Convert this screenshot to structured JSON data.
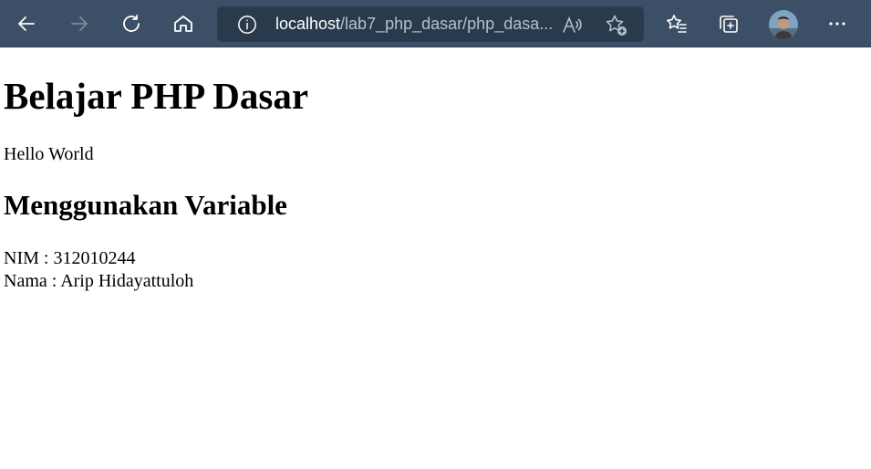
{
  "browser": {
    "url_host": "localhost",
    "url_path": "/lab7_php_dasar/php_dasa...",
    "colors": {
      "toolbar": "#3b4f66",
      "address_bar": "#2a3a4d"
    },
    "icons": [
      "back-arrow-icon",
      "forward-arrow-icon",
      "refresh-icon",
      "home-icon",
      "site-info-icon",
      "read-aloud-icon",
      "add-favorite-icon",
      "favorites-icon",
      "collections-icon",
      "avatar",
      "more-icon"
    ]
  },
  "page": {
    "heading": "Belajar PHP Dasar",
    "hello": "Hello World",
    "subheading": "Menggunakan Variable",
    "nim": "NIM : 312010244",
    "nama": "Nama : Arip Hidayattuloh"
  }
}
